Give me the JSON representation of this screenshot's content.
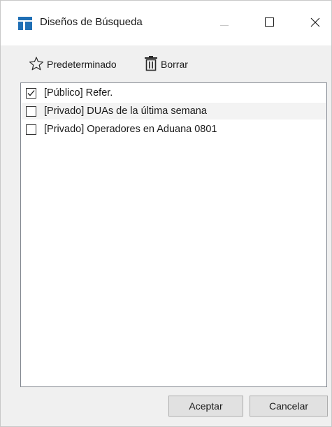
{
  "window": {
    "title": "Diseños de Búsqueda",
    "minimize_icon": "minimize-icon",
    "maximize_icon": "maximize-icon",
    "close_icon": "close-icon"
  },
  "toolbar": {
    "default_label": "Predeterminado",
    "default_icon": "star-icon",
    "delete_label": "Borrar",
    "delete_icon": "trash-icon"
  },
  "list": {
    "items": [
      {
        "label": "[Público] Refer.",
        "checked": true
      },
      {
        "label": "[Privado] DUAs de la última semana",
        "checked": false
      },
      {
        "label": "[Privado] Operadores en Aduana 0801",
        "checked": false
      }
    ]
  },
  "buttons": {
    "accept_label": "Aceptar",
    "cancel_label": "Cancelar"
  },
  "colors": {
    "app_icon": "#1f6fb5",
    "list_border": "#828790",
    "button_face": "#e1e1e1"
  }
}
